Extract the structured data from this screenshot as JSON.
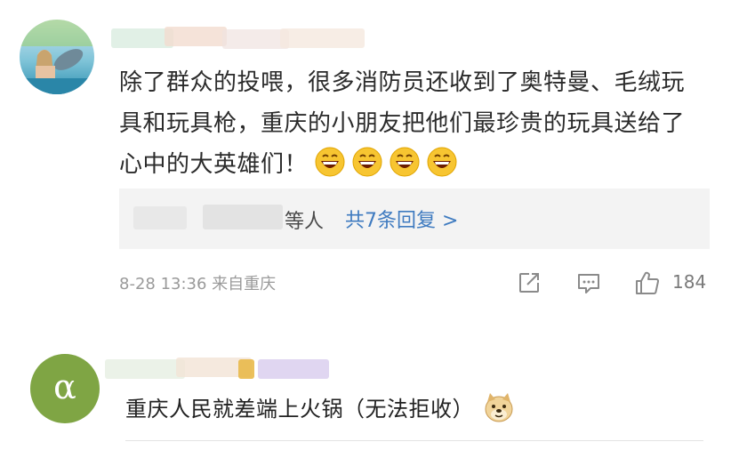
{
  "comment1": {
    "text": "除了群众的投喂，很多消防员还收到了奥特曼、毛绒玩具和玩具枪，重庆的小朋友把他们最珍贵的玩具送给了心中的大英雄们！",
    "emoji_icons": [
      "grinning-face-icon",
      "grinning-face-icon",
      "grinning-face-icon",
      "grinning-face-icon"
    ],
    "reply_names": "等人",
    "reply_link": "共7条回复 >",
    "meta": "8-28 13:36 来自重庆",
    "like_count": "184"
  },
  "comment2": {
    "avatar_letter": "α",
    "text": "重庆人民就差端上火锅（无法拒收）",
    "emoji_icon": "doge-icon"
  },
  "colors": {
    "link": "#3f7bc0",
    "meta": "#9a9a9a",
    "reply_bg": "#f3f3f3",
    "avatar2": "#7fa544"
  }
}
